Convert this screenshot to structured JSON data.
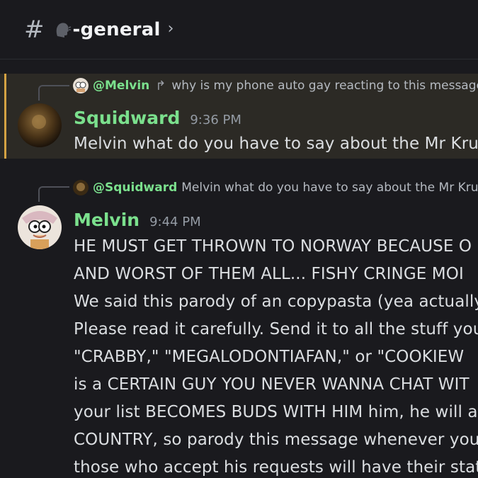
{
  "channel": {
    "hash": "#",
    "name": "-general",
    "chevron": "›"
  },
  "messages": [
    {
      "reply": {
        "mention": "@Melvin",
        "arrow": "↱",
        "text": "why is my phone auto gay reacting to this message"
      },
      "author": "Squidward",
      "time": "9:36 PM",
      "lines": [
        "Melvin what do you have to say about the Mr Krup"
      ],
      "highlighted": true,
      "accent": "#d4a243"
    },
    {
      "reply": {
        "mention": "@Squidward",
        "text": "Melvin what do you have to say about the Mr Krup"
      },
      "author": "Melvin",
      "time": "9:44 PM",
      "lines": [
        "HE MUST GET THROWN TO NORWAY BECAUSE O",
        "AND WORST OF THEM ALL... FISHY CRINGE MOI",
        "We said this parody of an copypasta (yea actually)",
        "Please read it carefully. Send it to all the stuff you'",
        "\"CRABBY,\" \"MEGALODONTIAFAN,\" or \"COOKIEW",
        "is a CERTAIN GUY YOU NEVER WANNA CHAT WIT",
        "your list BECOMES BUDS WITH HIM him, he will a",
        "COUNTRY, so parody this message whenever you c",
        "those who accept his requests will have their state"
      ]
    }
  ],
  "colors": {
    "background": "#1a1a1e",
    "username": "#7be08d",
    "highlight_bg": "#2c2a25"
  },
  "icons": {
    "channel_emoji": "speaking-head-icon",
    "reply_arrow": "reply-arrow-icon"
  }
}
